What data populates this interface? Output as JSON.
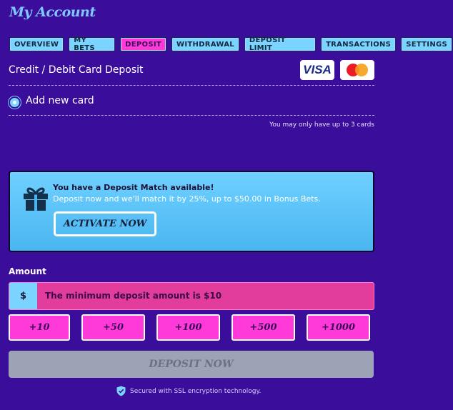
{
  "page": {
    "title": "My Account"
  },
  "tabs": [
    "OVERVIEW",
    "MY BETS",
    "DEPOSIT",
    "WITHDRAWAL",
    "DEPOSIT LIMIT",
    "TRANSACTIONS",
    "SETTINGS"
  ],
  "active_tab": "DEPOSIT",
  "deposit": {
    "heading": "Credit / Debit Card Deposit",
    "card_brands": [
      "VISA",
      "mastercard-icon"
    ],
    "add_new_card": "Add new card",
    "card_limit_note": "You may only have up to 3 cards"
  },
  "promo": {
    "heading": "You have a Deposit Match available!",
    "subtext": "Deposit now and we'll match it by 25%, up to $50.00 in Bonus Bets.",
    "cta": "ACTIVATE NOW"
  },
  "amount": {
    "label": "Amount",
    "currency_symbol": "$",
    "message": "The minimum deposit amount is $10",
    "quick_add": [
      "+10",
      "+50",
      "+100",
      "+500",
      "+1000"
    ]
  },
  "submit": {
    "label": "DEPOSIT NOW"
  },
  "footer": {
    "secured_text": "Secured with SSL encryption technology."
  },
  "colors": {
    "background": "#3a0e9a",
    "accent_blue": "#7ad4ff",
    "accent_pink": "#ff3ad8",
    "disabled": "#9ca3b4"
  }
}
